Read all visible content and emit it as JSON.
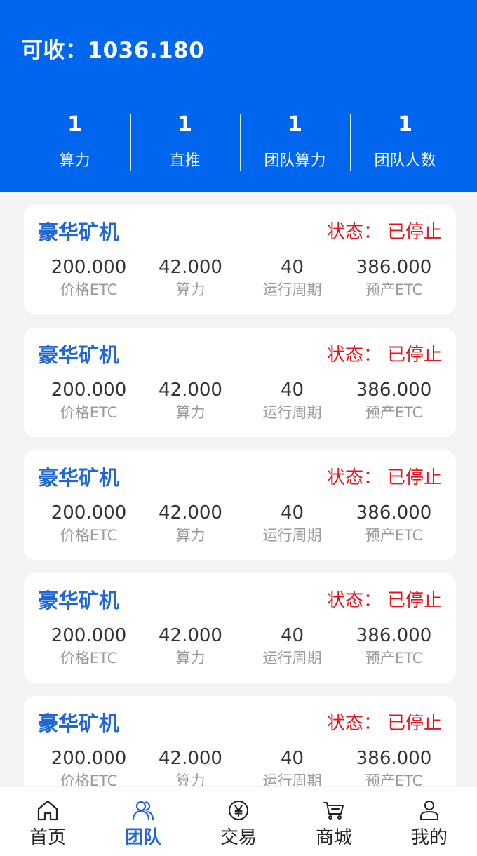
{
  "header": {
    "balance_label": "可收：",
    "balance_value": "1036.180",
    "stats": [
      {
        "value": "1",
        "label": "算力"
      },
      {
        "value": "1",
        "label": "直推"
      },
      {
        "value": "1",
        "label": "团队算力"
      },
      {
        "value": "1",
        "label": "团队人数"
      }
    ]
  },
  "cards": [
    {
      "title": "豪华矿机",
      "status_label": "状态：",
      "status_value": "已停止",
      "metrics": [
        {
          "value": "200.000",
          "label": "价格ETC"
        },
        {
          "value": "42.000",
          "label": "算力"
        },
        {
          "value": "40",
          "label": "运行周期"
        },
        {
          "value": "386.000",
          "label": "预产ETC"
        }
      ]
    },
    {
      "title": "豪华矿机",
      "status_label": "状态：",
      "status_value": "已停止",
      "metrics": [
        {
          "value": "200.000",
          "label": "价格ETC"
        },
        {
          "value": "42.000",
          "label": "算力"
        },
        {
          "value": "40",
          "label": "运行周期"
        },
        {
          "value": "386.000",
          "label": "预产ETC"
        }
      ]
    },
    {
      "title": "豪华矿机",
      "status_label": "状态：",
      "status_value": "已停止",
      "metrics": [
        {
          "value": "200.000",
          "label": "价格ETC"
        },
        {
          "value": "42.000",
          "label": "算力"
        },
        {
          "value": "40",
          "label": "运行周期"
        },
        {
          "value": "386.000",
          "label": "预产ETC"
        }
      ]
    },
    {
      "title": "豪华矿机",
      "status_label": "状态：",
      "status_value": "已停止",
      "metrics": [
        {
          "value": "200.000",
          "label": "价格ETC"
        },
        {
          "value": "42.000",
          "label": "算力"
        },
        {
          "value": "40",
          "label": "运行周期"
        },
        {
          "value": "386.000",
          "label": "预产ETC"
        }
      ]
    },
    {
      "title": "豪华矿机",
      "status_label": "状态：",
      "status_value": "已停止",
      "metrics": [
        {
          "value": "200.000",
          "label": "价格ETC"
        },
        {
          "value": "42.000",
          "label": "算力"
        },
        {
          "value": "40",
          "label": "运行周期"
        },
        {
          "value": "386.000",
          "label": "预产ETC"
        }
      ]
    }
  ],
  "tabbar": {
    "tabs": [
      {
        "label": "首页",
        "icon": "home-icon"
      },
      {
        "label": "团队",
        "icon": "team-icon",
        "active": true
      },
      {
        "label": "交易",
        "icon": "yen-icon"
      },
      {
        "label": "商城",
        "icon": "cart-icon"
      },
      {
        "label": "我的",
        "icon": "user-icon"
      }
    ]
  },
  "colors": {
    "primary": "#0066ee",
    "title_blue": "#1f66d6",
    "status_red": "#e4141e",
    "background": "#f4f4f5"
  }
}
